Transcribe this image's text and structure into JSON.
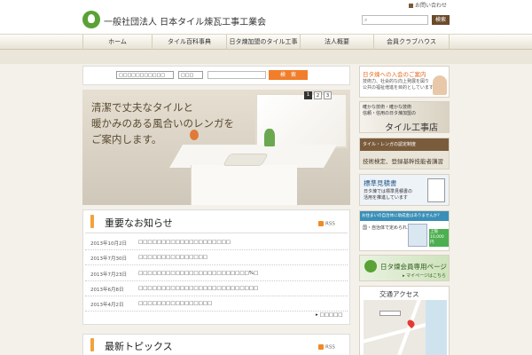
{
  "header": {
    "org_name": "一般社団法人 日本タイル煉瓦工事工業会",
    "contact_label": "お問い合わせ",
    "search_placeholder": "",
    "search_button": "検索"
  },
  "nav": {
    "items": [
      {
        "label": "ホーム"
      },
      {
        "label": "タイル百科事典"
      },
      {
        "label": "日タ煉加盟のタイル工事店"
      },
      {
        "label": "法人概要"
      },
      {
        "label": "会員クラブハウス"
      }
    ]
  },
  "searchbar": {
    "select1_value": "□□□□□□□□□□□",
    "select2_value": "□□□",
    "keyword_button": "検　索"
  },
  "hero": {
    "caption_line1": "清潔で丈夫なタイルと",
    "caption_line2": "暖かみのある風合いのレンガを",
    "caption_line3": "ご案内します。",
    "pages": [
      "1",
      "2",
      "3"
    ]
  },
  "news": {
    "title": "重要なお知らせ",
    "rss_label": "RSS",
    "items": [
      {
        "date": "2013年10月2日",
        "title": "□□□□□□□□□□□□□□□□□□□□"
      },
      {
        "date": "2013年7月30日",
        "title": "□□□□□□□□□□□□□□□"
      },
      {
        "date": "2013年7月23日",
        "title": "□□□□□□□□□□□□□□□□□□□□□□□□%□"
      },
      {
        "date": "2013年6月8日",
        "title": "□□□□□□□□□□□□□□□□□□□□□□□□□□"
      },
      {
        "date": "2013年4月2日",
        "title": "□□□□□□□□□□□□□□□□"
      }
    ],
    "list_link": "▸ □□□□□"
  },
  "topics": {
    "title": "最新トピックス",
    "rss_label": "RSS"
  },
  "sidebar": {
    "join": {
      "title": "日タ煉への入会のご案内",
      "line1": "技術力、社会的な向上発展を図り",
      "line2": "公共の福祉増進を目的としています"
    },
    "shop": {
      "line1": "確かな技術・確かな技術",
      "line2": "信頼・信用の日タ煉加盟の",
      "title": "タイル工事店"
    },
    "license": {
      "line1": "タイル・レンガの認定制度",
      "title": "技術検定、登録基幹技能者講習"
    },
    "estimate": {
      "title": "標準見積書",
      "line1": "日タ煉では標準見積書の",
      "line2": "活用を推進しています"
    },
    "subsidy": {
      "line1": "お住まいの自治体に助成金はありませんか？",
      "line2": "国・自治体で定められた",
      "badge": "上限 10,000円"
    },
    "member": {
      "title": "日タ煉会員専用ページ",
      "link": "▸ マイページはこちら"
    },
    "access": {
      "title": "交通アクセス"
    }
  },
  "colors": {
    "accent_green": "#5aa136",
    "accent_orange": "#f07e2a",
    "brown": "#6b4a2b"
  }
}
